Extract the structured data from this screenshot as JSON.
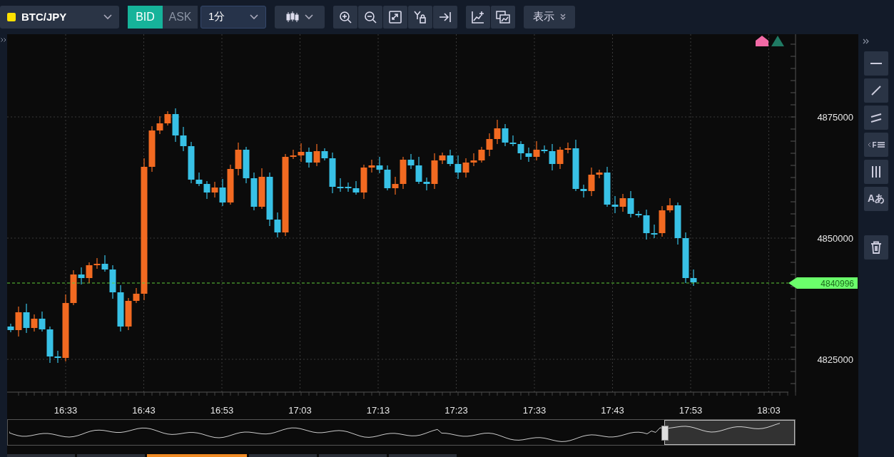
{
  "toolbar": {
    "symbol": "BTC/JPY",
    "price_sides": [
      {
        "label": "BID",
        "selected": true
      },
      {
        "label": "ASK",
        "selected": false
      }
    ],
    "interval": "1分",
    "display_menu": "表示"
  },
  "chart": {
    "y_labels": [
      "4875000",
      "4850000",
      "4825000"
    ],
    "x_labels": [
      "16:33",
      "16:43",
      "16:53",
      "17:03",
      "17:13",
      "17:23",
      "17:33",
      "17:43",
      "17:53",
      "18:03"
    ],
    "last_price": "4840996"
  },
  "drawing_tools": [
    {
      "kind": "hline"
    },
    {
      "kind": "trend"
    },
    {
      "kind": "channel"
    },
    {
      "kind": "fib",
      "label": "F"
    },
    {
      "kind": "vlines"
    },
    {
      "kind": "text",
      "label": "Aあ"
    },
    {
      "kind": "trash"
    }
  ]
}
